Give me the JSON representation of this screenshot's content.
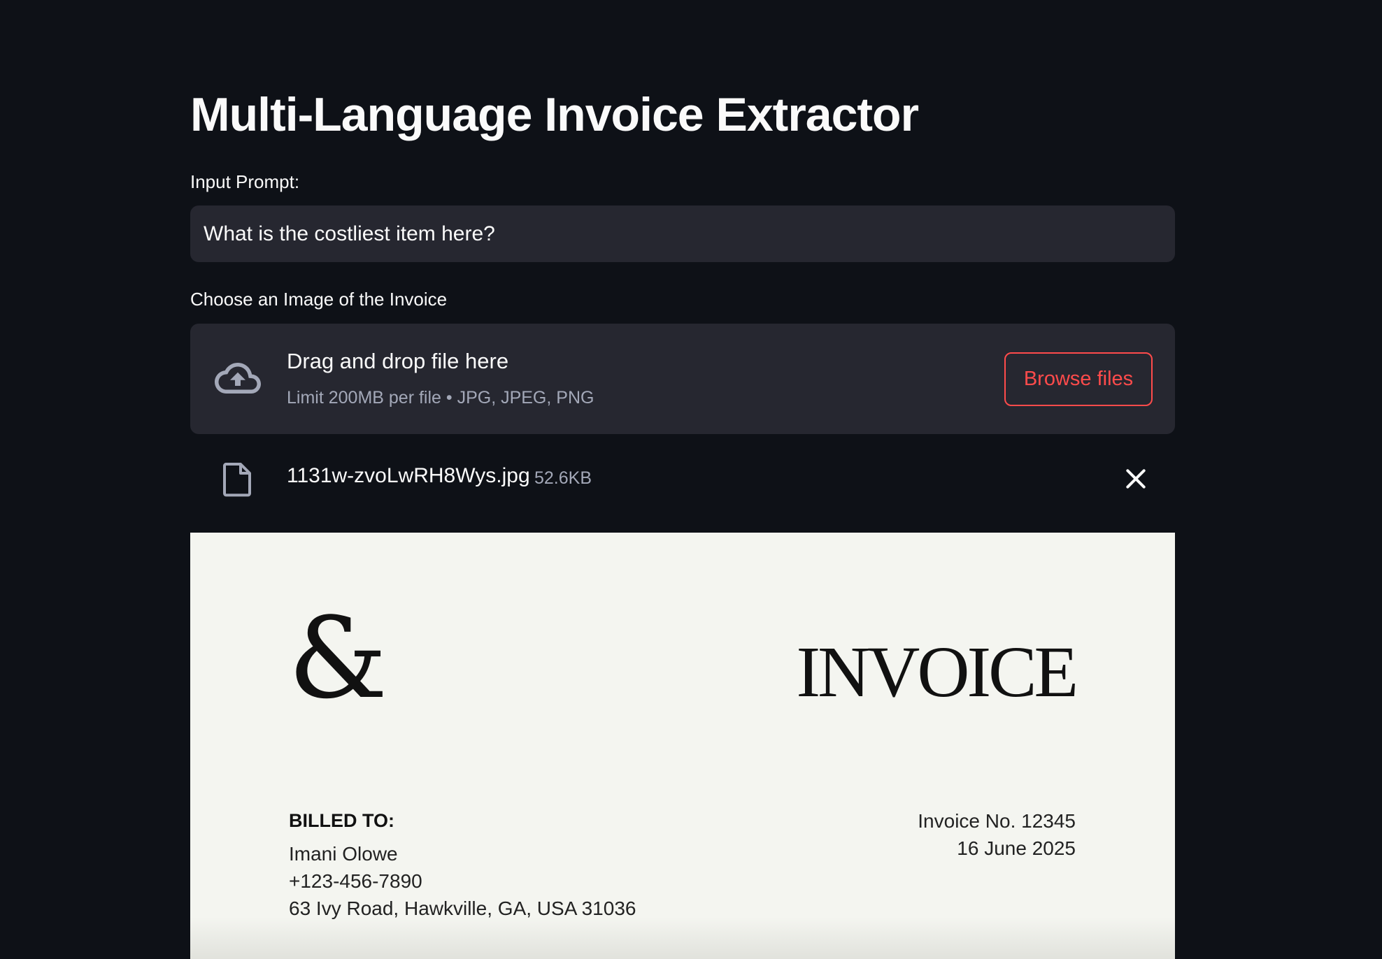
{
  "header": {
    "title": "Multi-Language Invoice Extractor"
  },
  "prompt": {
    "label": "Input Prompt:",
    "value": "What is the costliest item here?"
  },
  "uploader": {
    "label": "Choose an Image of the Invoice",
    "drag_text": "Drag and drop file here",
    "limit_text": "Limit 200MB per file • JPG, JPEG, PNG",
    "browse_label": "Browse files",
    "icon": "cloud-upload-icon"
  },
  "uploaded_file": {
    "name": "1131w-zvoLwRH8Wys.jpg",
    "size": "52.6KB",
    "icon": "file-icon"
  },
  "invoice_preview": {
    "logo": "&",
    "heading": "INVOICE",
    "billed_to_label": "BILLED TO:",
    "billed_name": "Imani Olowe",
    "billed_phone": "+123-456-7890",
    "billed_address": "63 Ivy Road, Hawkville, GA, USA 31036",
    "invoice_number": "Invoice No. 12345",
    "invoice_date": "16 June 2025"
  },
  "colors": {
    "background": "#0e1117",
    "surface": "#262730",
    "accent": "#ff4b4b",
    "muted_text": "#a3a8b8",
    "invoice_paper": "#f4f5f0"
  }
}
